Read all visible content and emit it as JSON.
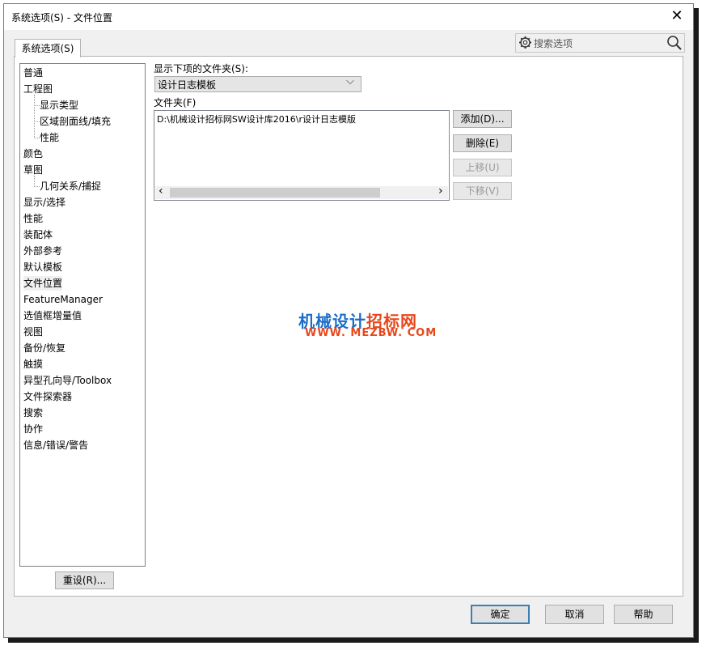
{
  "window": {
    "title": "系统选项(S) - 文件位置",
    "close_symbol": "✕",
    "close_icon": "close-icon"
  },
  "tab": {
    "label": "系统选项(S)"
  },
  "search": {
    "placeholder": "搜索选项",
    "gear_icon": "gear-icon",
    "search_icon": "search-icon"
  },
  "tree": {
    "items": [
      {
        "label": "普通",
        "level": 0
      },
      {
        "label": "工程图",
        "level": 0
      },
      {
        "label": "显示类型",
        "level": 1
      },
      {
        "label": "区域剖面线/填充",
        "level": 1
      },
      {
        "label": "性能",
        "level": 1
      },
      {
        "label": "颜色",
        "level": 0
      },
      {
        "label": "草图",
        "level": 0
      },
      {
        "label": "几何关系/捕捉",
        "level": 1
      },
      {
        "label": "显示/选择",
        "level": 0
      },
      {
        "label": "性能",
        "level": 0
      },
      {
        "label": "装配体",
        "level": 0
      },
      {
        "label": "外部参考",
        "level": 0
      },
      {
        "label": "默认模板",
        "level": 0
      },
      {
        "label": "文件位置",
        "level": 0,
        "selected": true
      },
      {
        "label": "FeatureManager",
        "level": 0
      },
      {
        "label": "选值框增量值",
        "level": 0
      },
      {
        "label": "视图",
        "level": 0
      },
      {
        "label": "备份/恢复",
        "level": 0
      },
      {
        "label": "触摸",
        "level": 0
      },
      {
        "label": "异型孔向导/Toolbox",
        "level": 0
      },
      {
        "label": "文件探索器",
        "level": 0
      },
      {
        "label": "搜索",
        "level": 0
      },
      {
        "label": "协作",
        "level": 0
      },
      {
        "label": "信息/错误/警告",
        "level": 0
      }
    ]
  },
  "reset_button": "重设(R)...",
  "show_folders_label": "显示下项的文件夹(S):",
  "folder_type_select": {
    "value": "设计日志模板",
    "arrow": "⌵"
  },
  "folders_label": "文件夹(F)",
  "folders_list": [
    "D:\\机械设计招标网SW设计库2016\\r设计日志模版"
  ],
  "scroll": {
    "left": "‹",
    "right": "›"
  },
  "side_buttons": {
    "add": "添加(D)...",
    "delete": "删除(E)",
    "move_up": "上移(U)",
    "move_down": "下移(V)"
  },
  "watermark": {
    "line1_part1": "机械设计",
    "line1_part2": "招标网",
    "line2": "WWW. MEZBW. COM",
    "color_blue": "#1a6ec8",
    "color_orange": "#e8471b"
  },
  "footer": {
    "ok": "确定",
    "cancel": "取消",
    "help": "帮助"
  }
}
